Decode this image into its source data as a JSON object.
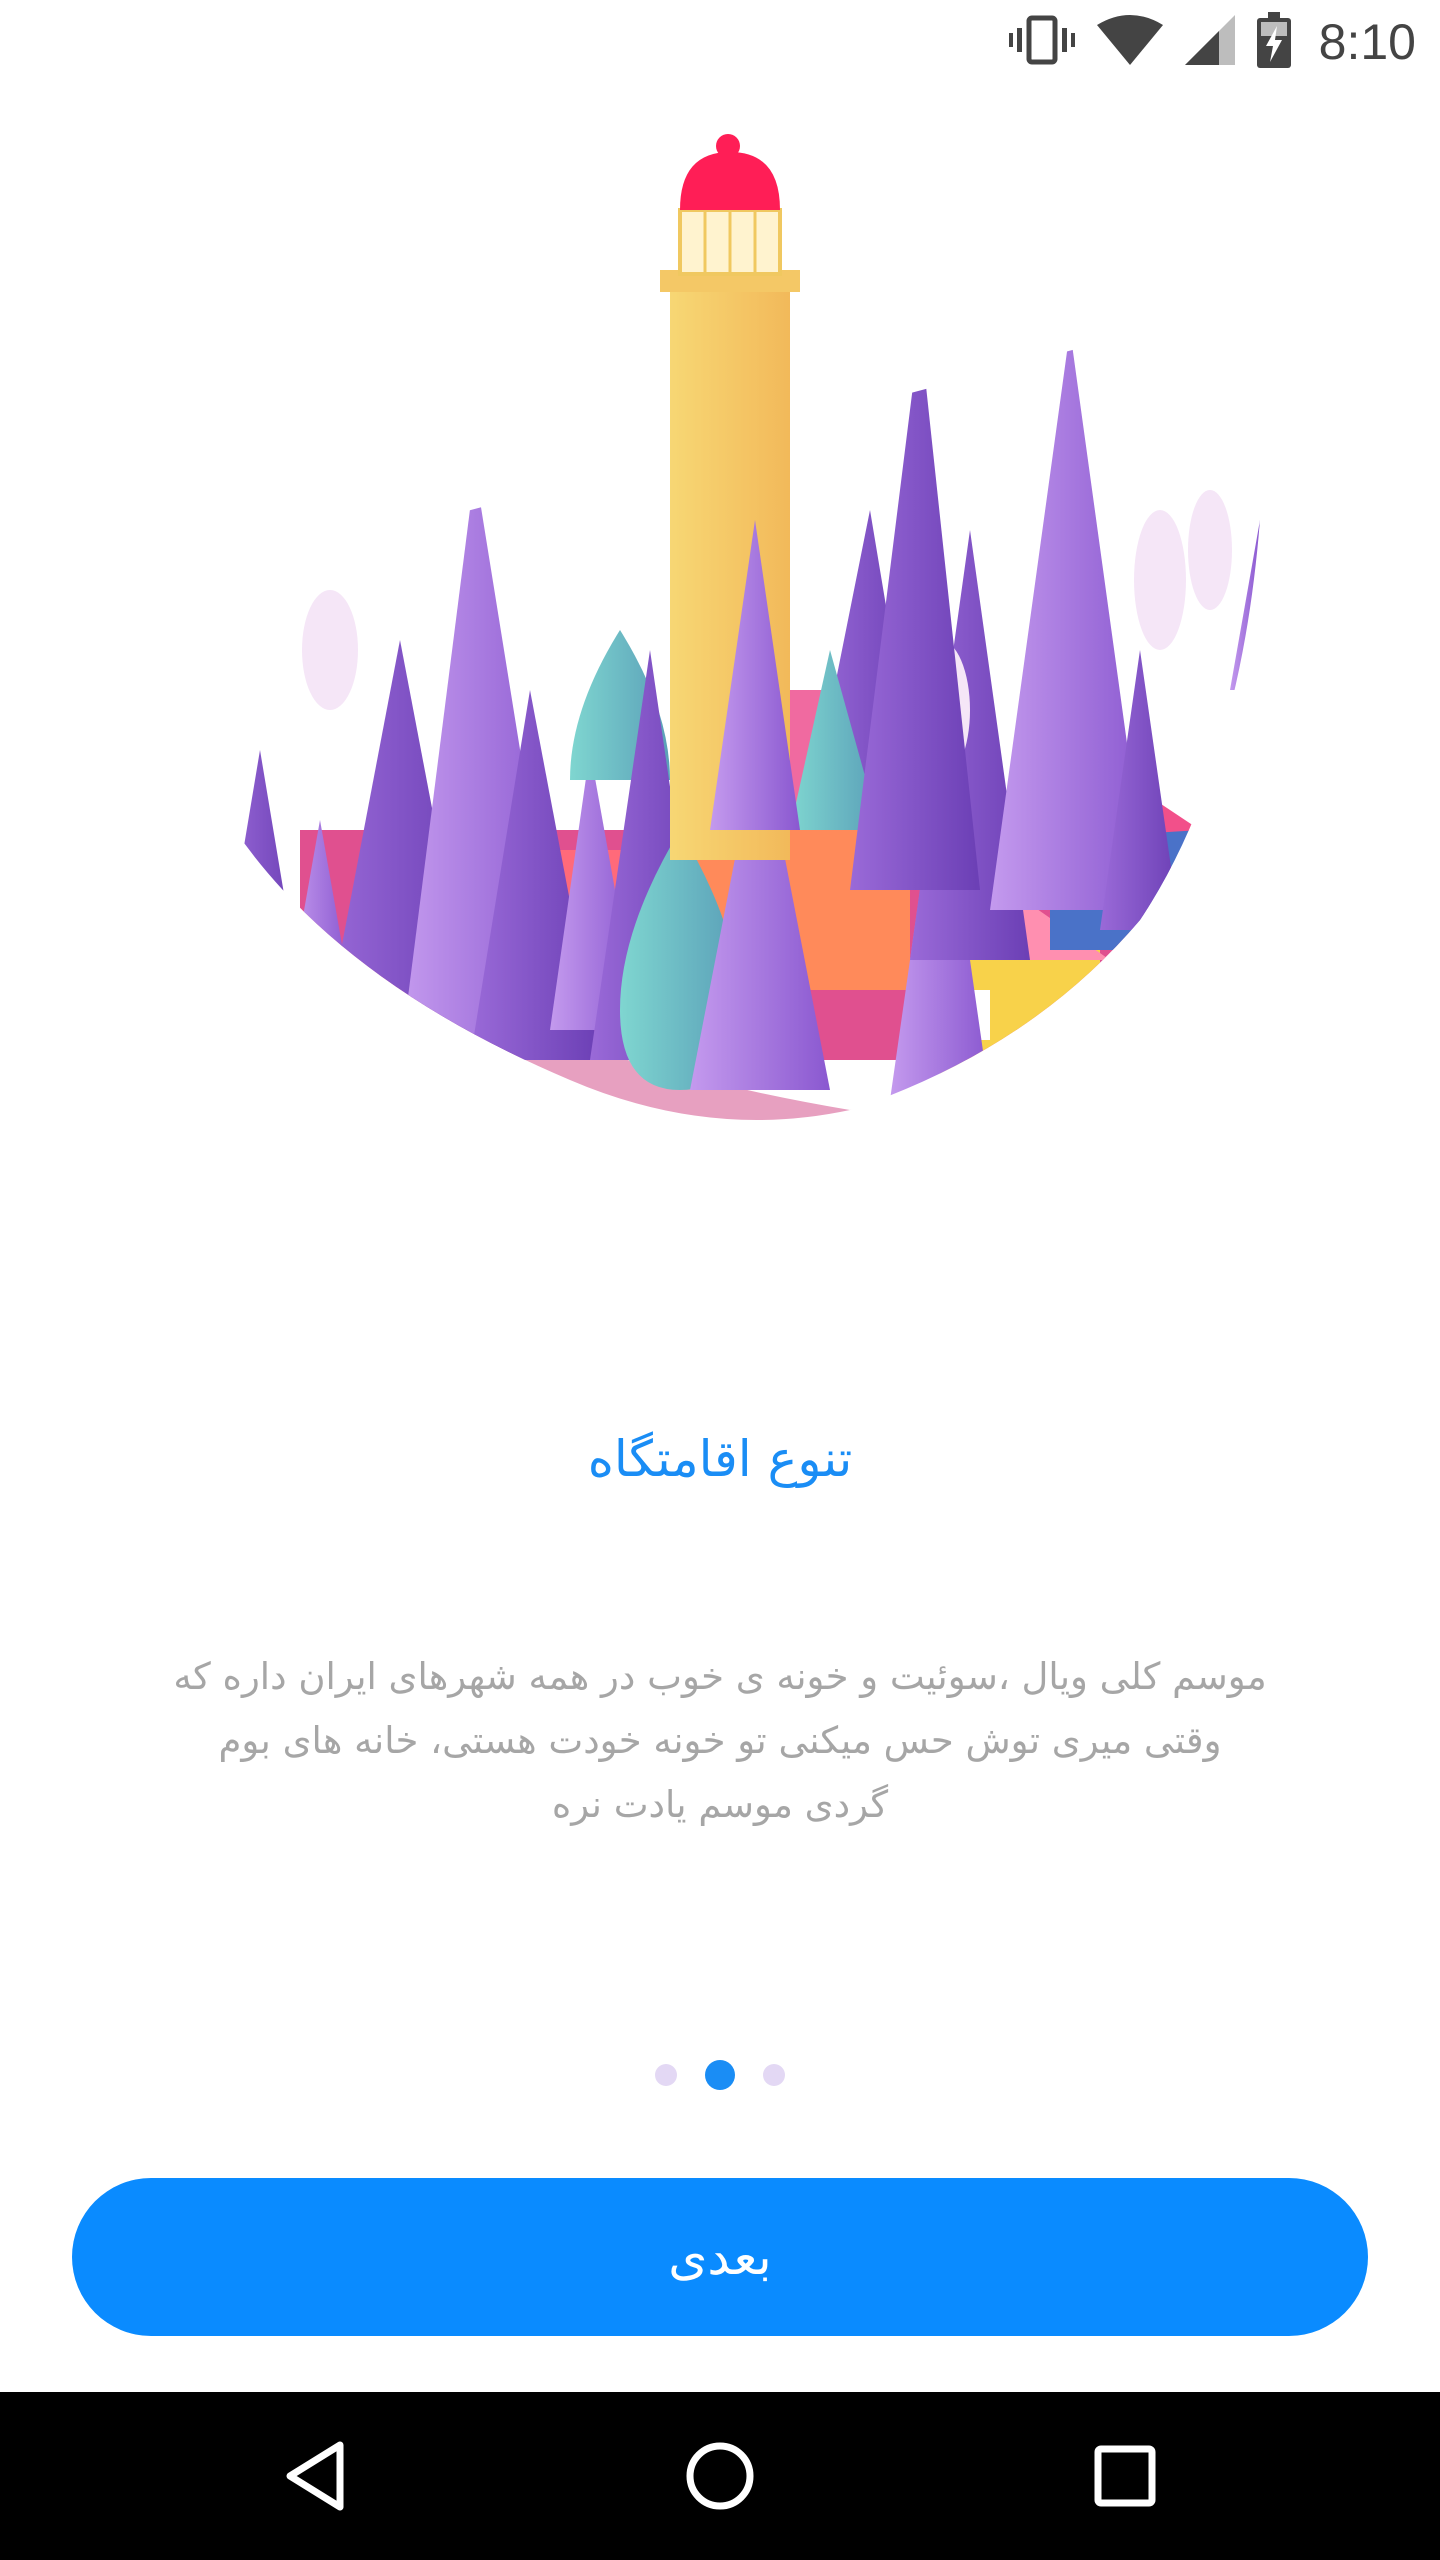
{
  "status_bar": {
    "time": "8:10",
    "icons": [
      "vibrate-icon",
      "wifi-icon",
      "cell-signal-icon",
      "battery-charging-icon"
    ]
  },
  "onboarding": {
    "illustration": "lighthouse-village-illustration",
    "title": "تنوع اقامتگاه",
    "description_lines": [
      "موسم کلی ویال ،سوئیت و خونه ی خوب در همه شهرهای ایران داره که",
      "وقتی میری توش حس میکنی تو خونه خودت هستی، خانه های بوم",
      "گردی موسم یادت نره"
    ],
    "pager": {
      "count": 3,
      "active_index": 1
    },
    "next_label": "بعدی"
  },
  "navigation": {
    "icons": [
      "back-icon",
      "home-icon",
      "recents-icon"
    ]
  },
  "colors": {
    "accent": "#0a8bff",
    "title": "#1a8df5",
    "description": "#a6a6a6",
    "dot_inactive": "#e3d8f4",
    "nav_bar": "#000000"
  }
}
